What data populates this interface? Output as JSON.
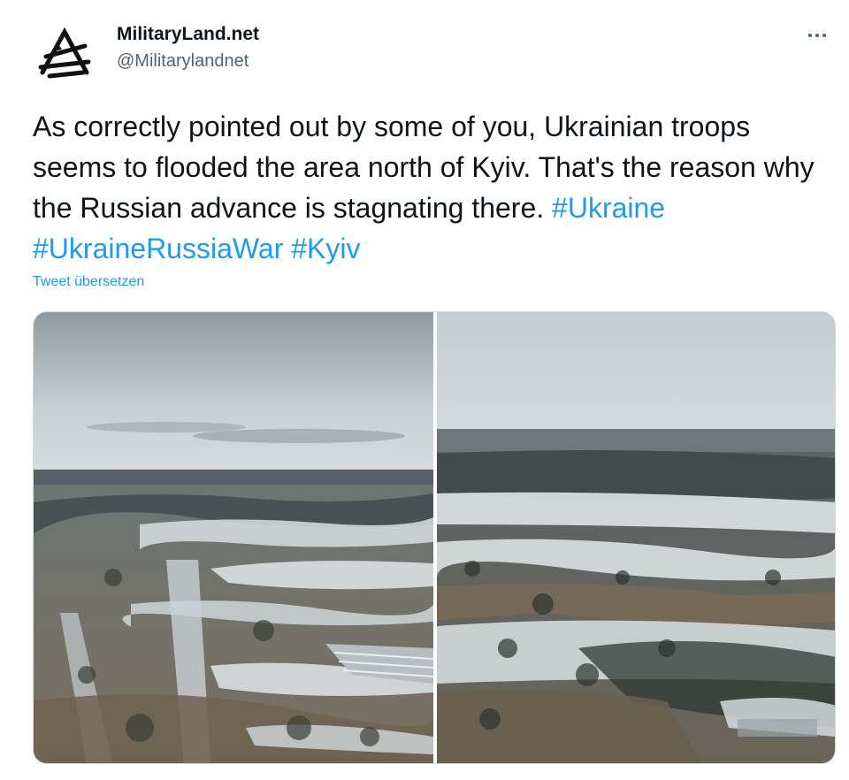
{
  "author": {
    "display_name": "MilitaryLand.net",
    "handle": "@Militarylandnet",
    "avatar_icon": "militaryland-logo-icon"
  },
  "tweet": {
    "text_parts": [
      "As correctly pointed out by some of you, Ukrainian troops seems to flooded the area north of Kyiv. That's the reason why the Russian advance is stagnating there. "
    ],
    "hashtags": [
      "#Ukraine",
      "#UkraineRussiaWar",
      "#Kyiv"
    ],
    "translate_label": "Tweet übersetzen"
  },
  "media": {
    "photo_count": 2
  },
  "colors": {
    "text": "#0f1419",
    "secondary": "#536471",
    "link": "#1d9bf0",
    "border": "#cfd9de"
  }
}
